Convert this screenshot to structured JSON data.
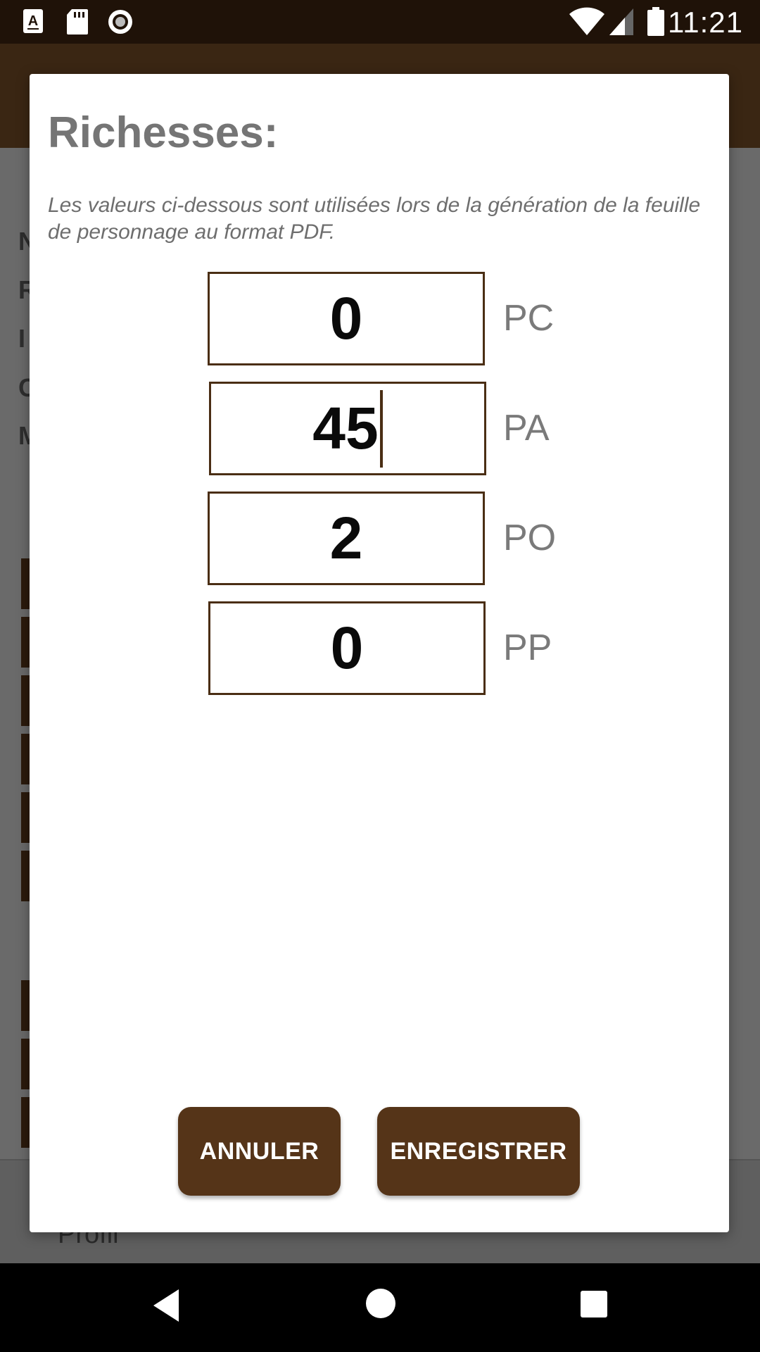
{
  "status_bar": {
    "time": "11:21",
    "left_icons": [
      "keyboard-a-icon",
      "sd-card-icon",
      "record-icon"
    ],
    "right_icons": [
      "wifi-icon",
      "signal-icon",
      "battery-icon"
    ]
  },
  "background_app": {
    "side_letters": [
      "N",
      "R",
      "I",
      "C",
      "M"
    ],
    "footer_label": "Profil"
  },
  "dialog": {
    "title": "Richesses:",
    "description": "Les valeurs ci-dessous sont utilisées lors de la génération de la feuille de personnage au format PDF.",
    "fields": [
      {
        "value": "0",
        "unit": "PC"
      },
      {
        "value": "45",
        "unit": "PA"
      },
      {
        "value": "2",
        "unit": "PO"
      },
      {
        "value": "0",
        "unit": "PP"
      }
    ],
    "cancel_label": "ANNULER",
    "save_label": "ENREGISTRER"
  },
  "nav_bar": {
    "icons": [
      "back-icon",
      "home-icon",
      "recents-icon"
    ]
  },
  "colors": {
    "primary_brown": "#553418",
    "status_bar": "#1f1208",
    "field_border": "#4a2e14"
  }
}
